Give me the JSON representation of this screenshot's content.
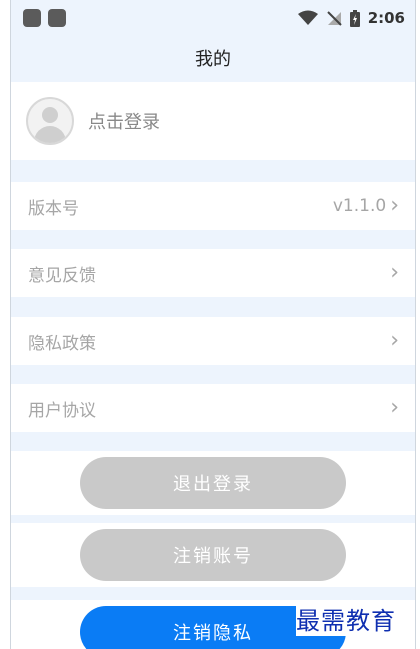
{
  "status_bar": {
    "time": "2:06"
  },
  "header": {
    "title": "我的"
  },
  "login": {
    "label": "点击登录"
  },
  "menu": [
    {
      "label": "版本号",
      "value": "v1.1.0"
    },
    {
      "label": "意见反馈",
      "value": ""
    },
    {
      "label": "隐私政策",
      "value": ""
    },
    {
      "label": "用户协议",
      "value": ""
    }
  ],
  "buttons": {
    "logout": "退出登录",
    "cancel_account": "注销账号",
    "cancel_privacy": "注销隐私"
  },
  "watermark": "最需教育",
  "colors": {
    "accent": "#0a7cf5",
    "disabled_button": "#c9c9c9",
    "background": "#edf4fd"
  }
}
